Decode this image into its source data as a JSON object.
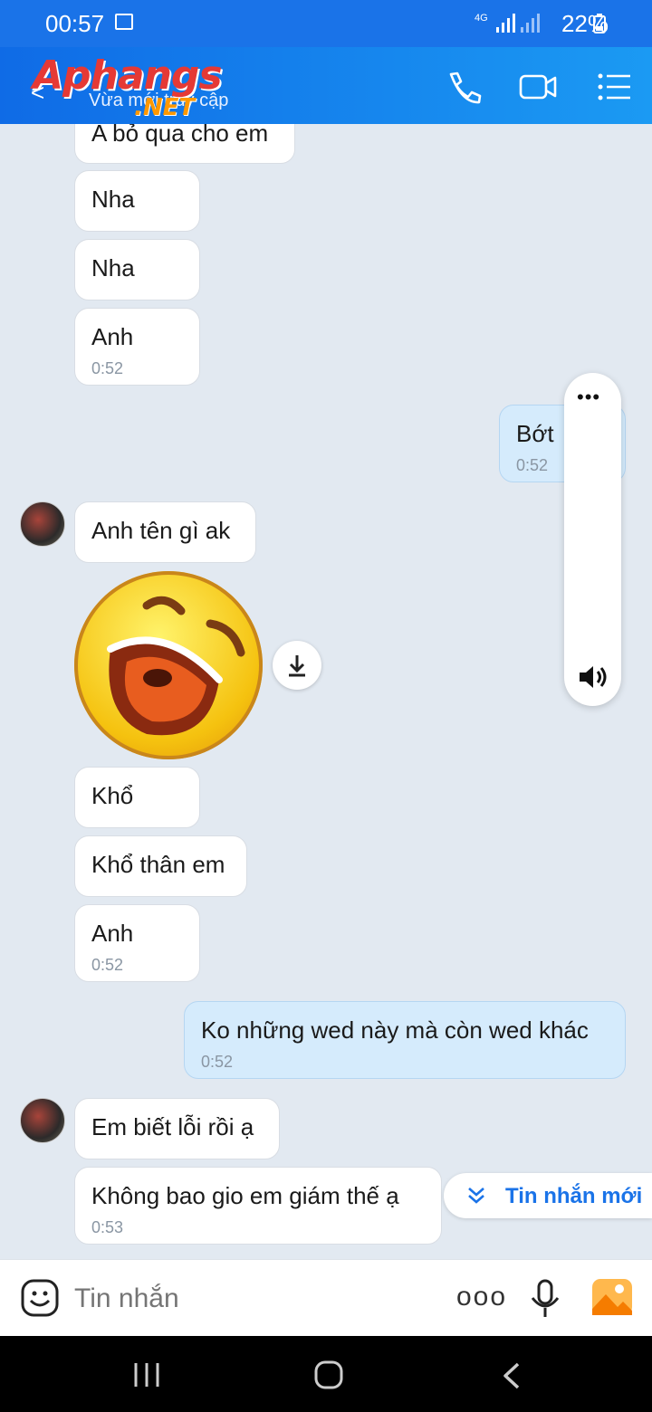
{
  "status_bar": {
    "time": "00:57",
    "network": "4G",
    "battery": "22%"
  },
  "header": {
    "logo_main": "Aphangs",
    "logo_sub": ".NET",
    "subtitle": "Vừa mới truy cập"
  },
  "messages": {
    "m1": {
      "text": "A bỏ qua cho em"
    },
    "m2": {
      "text": "Nha"
    },
    "m3": {
      "text": "Nha"
    },
    "m4": {
      "text": "Anh",
      "time": "0:52"
    },
    "m5": {
      "text": "Bớt",
      "time": "0:52"
    },
    "m6": {
      "text": "Anh tên gì ak"
    },
    "m7": {
      "text": "Khổ"
    },
    "m8": {
      "text": "Khổ thân em"
    },
    "m9": {
      "text": "Anh",
      "time": "0:52"
    },
    "m10": {
      "text": "Ko những wed này mà còn wed khác",
      "time": "0:52"
    },
    "m11": {
      "text": "Em biết lỗi rồi ạ"
    },
    "m12": {
      "text": "Không bao gio em giám thế ạ",
      "time": "0:53"
    }
  },
  "float_panel": {
    "more": "•••"
  },
  "new_message_button": {
    "label": "Tin nhắn mới"
  },
  "composer": {
    "placeholder": "Tin nhắn",
    "more": "ooo"
  },
  "colors": {
    "primary": "#1a73e8",
    "mine_bubble": "#d5ebfc",
    "background": "#e2e9f1"
  },
  "icons": [
    "image-icon",
    "signal-icon",
    "battery-icon",
    "back-arrow-icon",
    "phone-icon",
    "video-call-icon",
    "menu-list-icon",
    "download-icon",
    "speaker-icon",
    "double-chevron-down-icon",
    "emoji-icon",
    "microphone-icon",
    "gallery-icon",
    "nav-recents-icon",
    "nav-home-icon",
    "nav-back-icon"
  ]
}
